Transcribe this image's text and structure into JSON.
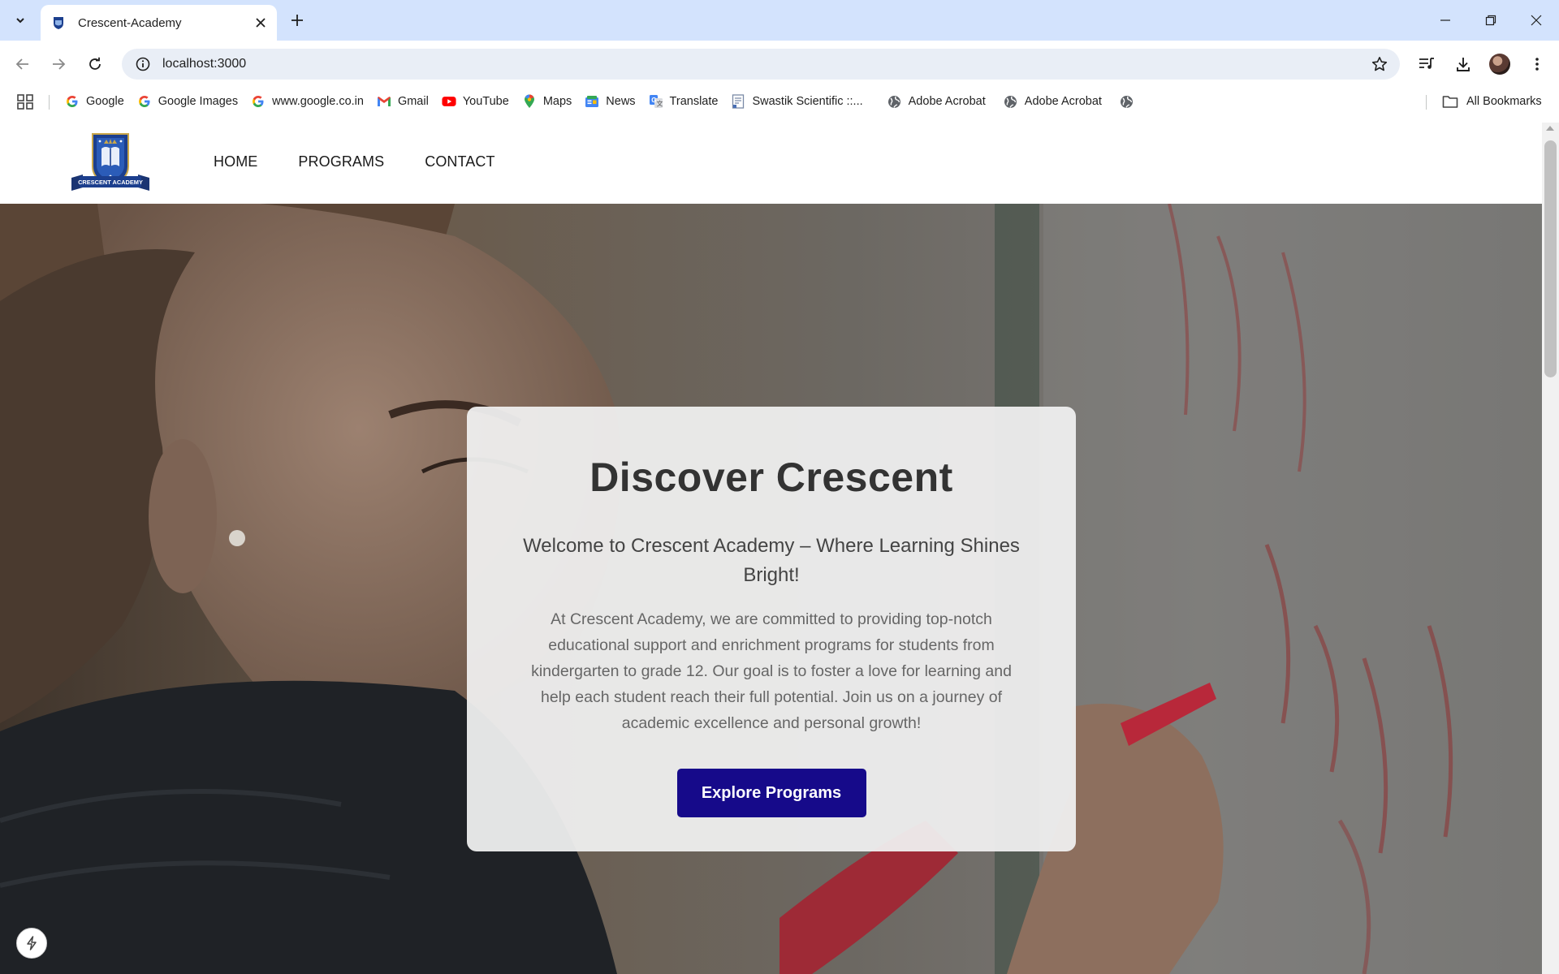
{
  "browser": {
    "tab_title": "Crescent-Academy",
    "url": "localhost:3000",
    "bookmarks": [
      {
        "label": "Google",
        "icon": "google-g-icon"
      },
      {
        "label": "Google Images",
        "icon": "google-g-icon"
      },
      {
        "label": "www.google.co.in",
        "icon": "google-g-icon"
      },
      {
        "label": "Gmail",
        "icon": "gmail-icon"
      },
      {
        "label": "YouTube",
        "icon": "youtube-icon"
      },
      {
        "label": "Maps",
        "icon": "maps-pin-icon"
      },
      {
        "label": "News",
        "icon": "news-icon"
      },
      {
        "label": "Translate",
        "icon": "translate-icon"
      },
      {
        "label": "Swastik Scientific ::...",
        "icon": "document-icon"
      },
      {
        "label": "Adobe Acrobat",
        "icon": "globe-icon"
      },
      {
        "label": "Adobe Acrobat",
        "icon": "globe-icon"
      },
      {
        "label": "",
        "icon": "globe-icon"
      }
    ],
    "all_bookmarks_label": "All Bookmarks"
  },
  "site": {
    "logo_text": "CRESCENT ACADEMY",
    "nav": {
      "home": "HOME",
      "programs": "PROGRAMS",
      "contact": "CONTACT"
    }
  },
  "hero": {
    "title": "Discover Crescent",
    "subtitle": "Welcome to Crescent Academy – Where Learning Shines Bright!",
    "body": "At Crescent Academy, we are committed to providing top-notch educational support and enrichment programs for students from kindergarten to grade 12. Our goal is to foster a love for learning and help each student reach their full potential. Join us on a journey of academic excellence and personal growth!",
    "cta_label": "Explore Programs"
  },
  "colors": {
    "tabstrip": "#d3e3fd",
    "cta_background": "#160a8a",
    "card_background": "#f0f0f0",
    "logo_navy": "#1c3f8e"
  }
}
